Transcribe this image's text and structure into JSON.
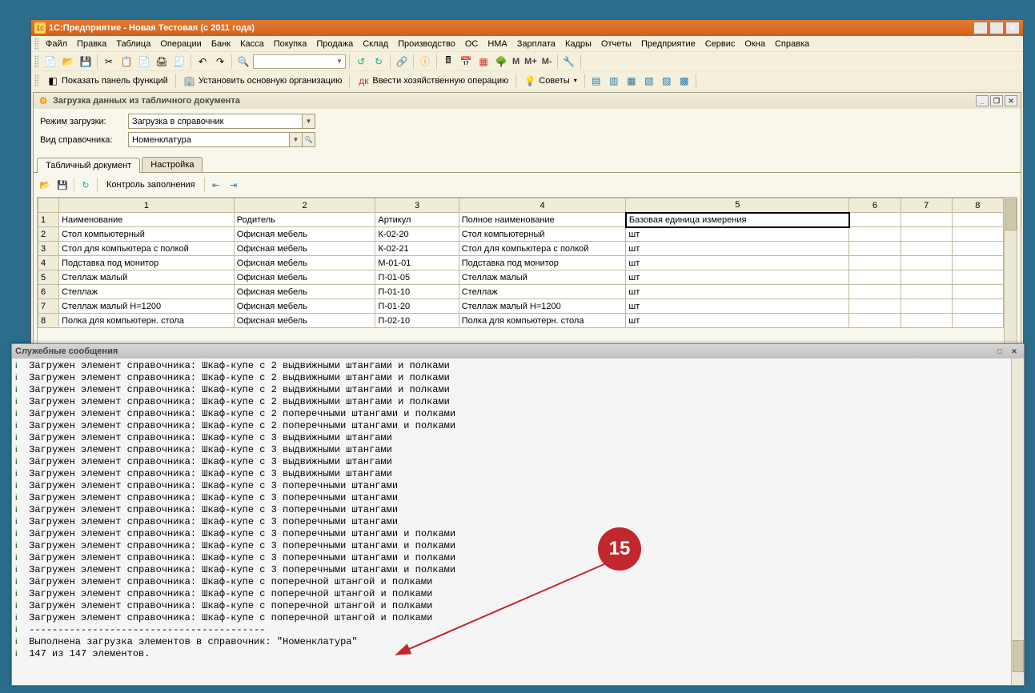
{
  "app": {
    "title": "1С:Предприятие - Новая Тестовая (с 2011 года)"
  },
  "menubar": [
    "Файл",
    "Правка",
    "Таблица",
    "Операции",
    "Банк",
    "Касса",
    "Покупка",
    "Продажа",
    "Склад",
    "Производство",
    "ОС",
    "НМА",
    "Зарплата",
    "Кадры",
    "Отчеты",
    "Предприятие",
    "Сервис",
    "Окна",
    "Справка"
  ],
  "toolbar2": {
    "show_panel": "Показать панель функций",
    "set_org": "Установить основную организацию",
    "enter_op": "Ввести хозяйственную операцию",
    "tips": "Советы"
  },
  "subwindow": {
    "title": "Загрузка данных из табличного документа",
    "mode_label": "Режим загрузки:",
    "mode_value": "Загрузка в справочник",
    "ref_label": "Вид справочника:",
    "ref_value": "Номенклатура",
    "tabs": {
      "doc": "Табличный документ",
      "settings": "Настройка"
    },
    "check_btn": "Контроль заполнения"
  },
  "grid": {
    "col_headers": [
      "",
      "1",
      "2",
      "3",
      "4",
      "5",
      "6",
      "7",
      "8"
    ],
    "row1": [
      "1",
      "Наименование",
      "Родитель",
      "Артикул",
      "Полное наименование",
      "Базовая единица измерения",
      "",
      "",
      ""
    ],
    "rows": [
      [
        "2",
        "Стол компьютерный",
        "Офисная мебель",
        "К-02-20",
        "Стол компьютерный",
        "шт"
      ],
      [
        "3",
        "Стол для компьютера с полкой",
        "Офисная мебель",
        "К-02-21",
        "Стол для компьютера с полкой",
        "шт"
      ],
      [
        "4",
        "Подставка под монитор",
        "Офисная мебель",
        "М-01-01",
        "Подставка под монитор",
        "шт"
      ],
      [
        "5",
        "Стеллаж малый",
        "Офисная мебель",
        "П-01-05",
        "Стеллаж малый",
        "шт"
      ],
      [
        "6",
        "Стеллаж",
        "Офисная мебель",
        "П-01-10",
        "Стеллаж",
        "шт"
      ],
      [
        "7",
        "Стеллаж малый Н=1200",
        "Офисная мебель",
        "П-01-20",
        "Стеллаж малый Н=1200",
        "шт"
      ],
      [
        "8",
        "Полка для компьютерн. стола",
        "Офисная мебель",
        "П-02-10",
        "Полка для компьютерн. стола",
        "шт"
      ]
    ]
  },
  "log": {
    "title": "Служебные сообщения",
    "lines": [
      "Загружен элемент справочника: Шкаф-купе с 2 выдвижными штангами и полками",
      "Загружен элемент справочника: Шкаф-купе с 2 выдвижными штангами и полками",
      "Загружен элемент справочника: Шкаф-купе с 2 выдвижными штангами и полками",
      "Загружен элемент справочника: Шкаф-купе с 2 выдвижными штангами и полками",
      "Загружен элемент справочника: Шкаф-купе с 2 поперечными штангами и полками",
      "Загружен элемент справочника: Шкаф-купе с 2 поперечными штангами и полками",
      "Загружен элемент справочника: Шкаф-купе с 3 выдвижными штангами",
      "Загружен элемент справочника: Шкаф-купе с 3 выдвижными штангами",
      "Загружен элемент справочника: Шкаф-купе с 3 выдвижными штангами",
      "Загружен элемент справочника: Шкаф-купе с 3 выдвижными штангами",
      "Загружен элемент справочника: Шкаф-купе с 3 поперечными штангами",
      "Загружен элемент справочника: Шкаф-купе с 3 поперечными штангами",
      "Загружен элемент справочника: Шкаф-купе с 3 поперечными штангами",
      "Загружен элемент справочника: Шкаф-купе с 3 поперечными штангами",
      "Загружен элемент справочника: Шкаф-купе с 3 поперечными штангами и полками",
      "Загружен элемент справочника: Шкаф-купе с 3 поперечными штангами и полками",
      "Загружен элемент справочника: Шкаф-купе с 3 поперечными штангами и полками",
      "Загружен элемент справочника: Шкаф-купе с 3 поперечными штангами и полками",
      "Загружен элемент справочника: Шкаф-купе с поперечной штангой и полками",
      "Загружен элемент справочника: Шкаф-купе с поперечной штангой и полками",
      "Загружен элемент справочника: Шкаф-купе с поперечной штангой и полками",
      "Загружен элемент справочника: Шкаф-купе с поперечной штангой и полками",
      "-----------------------------------------",
      "Выполнена загрузка элементов в справочник: \"Номенклатура\"",
      "147 из 147 элементов."
    ]
  },
  "annotation": {
    "number": "15"
  }
}
